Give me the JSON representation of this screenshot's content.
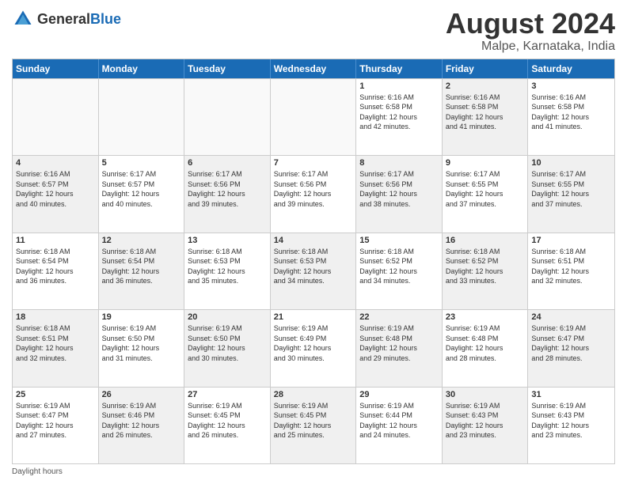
{
  "header": {
    "logo": {
      "general": "General",
      "blue": "Blue"
    },
    "title": "August 2024",
    "location": "Malpe, Karnataka, India"
  },
  "weekdays": [
    "Sunday",
    "Monday",
    "Tuesday",
    "Wednesday",
    "Thursday",
    "Friday",
    "Saturday"
  ],
  "weeks": [
    [
      {
        "day": "",
        "info": "",
        "shaded": false,
        "empty": true
      },
      {
        "day": "",
        "info": "",
        "shaded": false,
        "empty": true
      },
      {
        "day": "",
        "info": "",
        "shaded": false,
        "empty": true
      },
      {
        "day": "",
        "info": "",
        "shaded": false,
        "empty": true
      },
      {
        "day": "1",
        "info": "Sunrise: 6:16 AM\nSunset: 6:58 PM\nDaylight: 12 hours\nand 42 minutes.",
        "shaded": false,
        "empty": false
      },
      {
        "day": "2",
        "info": "Sunrise: 6:16 AM\nSunset: 6:58 PM\nDaylight: 12 hours\nand 41 minutes.",
        "shaded": true,
        "empty": false
      },
      {
        "day": "3",
        "info": "Sunrise: 6:16 AM\nSunset: 6:58 PM\nDaylight: 12 hours\nand 41 minutes.",
        "shaded": false,
        "empty": false
      }
    ],
    [
      {
        "day": "4",
        "info": "Sunrise: 6:16 AM\nSunset: 6:57 PM\nDaylight: 12 hours\nand 40 minutes.",
        "shaded": true,
        "empty": false
      },
      {
        "day": "5",
        "info": "Sunrise: 6:17 AM\nSunset: 6:57 PM\nDaylight: 12 hours\nand 40 minutes.",
        "shaded": false,
        "empty": false
      },
      {
        "day": "6",
        "info": "Sunrise: 6:17 AM\nSunset: 6:56 PM\nDaylight: 12 hours\nand 39 minutes.",
        "shaded": true,
        "empty": false
      },
      {
        "day": "7",
        "info": "Sunrise: 6:17 AM\nSunset: 6:56 PM\nDaylight: 12 hours\nand 39 minutes.",
        "shaded": false,
        "empty": false
      },
      {
        "day": "8",
        "info": "Sunrise: 6:17 AM\nSunset: 6:56 PM\nDaylight: 12 hours\nand 38 minutes.",
        "shaded": true,
        "empty": false
      },
      {
        "day": "9",
        "info": "Sunrise: 6:17 AM\nSunset: 6:55 PM\nDaylight: 12 hours\nand 37 minutes.",
        "shaded": false,
        "empty": false
      },
      {
        "day": "10",
        "info": "Sunrise: 6:17 AM\nSunset: 6:55 PM\nDaylight: 12 hours\nand 37 minutes.",
        "shaded": true,
        "empty": false
      }
    ],
    [
      {
        "day": "11",
        "info": "Sunrise: 6:18 AM\nSunset: 6:54 PM\nDaylight: 12 hours\nand 36 minutes.",
        "shaded": false,
        "empty": false
      },
      {
        "day": "12",
        "info": "Sunrise: 6:18 AM\nSunset: 6:54 PM\nDaylight: 12 hours\nand 36 minutes.",
        "shaded": true,
        "empty": false
      },
      {
        "day": "13",
        "info": "Sunrise: 6:18 AM\nSunset: 6:53 PM\nDaylight: 12 hours\nand 35 minutes.",
        "shaded": false,
        "empty": false
      },
      {
        "day": "14",
        "info": "Sunrise: 6:18 AM\nSunset: 6:53 PM\nDaylight: 12 hours\nand 34 minutes.",
        "shaded": true,
        "empty": false
      },
      {
        "day": "15",
        "info": "Sunrise: 6:18 AM\nSunset: 6:52 PM\nDaylight: 12 hours\nand 34 minutes.",
        "shaded": false,
        "empty": false
      },
      {
        "day": "16",
        "info": "Sunrise: 6:18 AM\nSunset: 6:52 PM\nDaylight: 12 hours\nand 33 minutes.",
        "shaded": true,
        "empty": false
      },
      {
        "day": "17",
        "info": "Sunrise: 6:18 AM\nSunset: 6:51 PM\nDaylight: 12 hours\nand 32 minutes.",
        "shaded": false,
        "empty": false
      }
    ],
    [
      {
        "day": "18",
        "info": "Sunrise: 6:18 AM\nSunset: 6:51 PM\nDaylight: 12 hours\nand 32 minutes.",
        "shaded": true,
        "empty": false
      },
      {
        "day": "19",
        "info": "Sunrise: 6:19 AM\nSunset: 6:50 PM\nDaylight: 12 hours\nand 31 minutes.",
        "shaded": false,
        "empty": false
      },
      {
        "day": "20",
        "info": "Sunrise: 6:19 AM\nSunset: 6:50 PM\nDaylight: 12 hours\nand 30 minutes.",
        "shaded": true,
        "empty": false
      },
      {
        "day": "21",
        "info": "Sunrise: 6:19 AM\nSunset: 6:49 PM\nDaylight: 12 hours\nand 30 minutes.",
        "shaded": false,
        "empty": false
      },
      {
        "day": "22",
        "info": "Sunrise: 6:19 AM\nSunset: 6:48 PM\nDaylight: 12 hours\nand 29 minutes.",
        "shaded": true,
        "empty": false
      },
      {
        "day": "23",
        "info": "Sunrise: 6:19 AM\nSunset: 6:48 PM\nDaylight: 12 hours\nand 28 minutes.",
        "shaded": false,
        "empty": false
      },
      {
        "day": "24",
        "info": "Sunrise: 6:19 AM\nSunset: 6:47 PM\nDaylight: 12 hours\nand 28 minutes.",
        "shaded": true,
        "empty": false
      }
    ],
    [
      {
        "day": "25",
        "info": "Sunrise: 6:19 AM\nSunset: 6:47 PM\nDaylight: 12 hours\nand 27 minutes.",
        "shaded": false,
        "empty": false
      },
      {
        "day": "26",
        "info": "Sunrise: 6:19 AM\nSunset: 6:46 PM\nDaylight: 12 hours\nand 26 minutes.",
        "shaded": true,
        "empty": false
      },
      {
        "day": "27",
        "info": "Sunrise: 6:19 AM\nSunset: 6:45 PM\nDaylight: 12 hours\nand 26 minutes.",
        "shaded": false,
        "empty": false
      },
      {
        "day": "28",
        "info": "Sunrise: 6:19 AM\nSunset: 6:45 PM\nDaylight: 12 hours\nand 25 minutes.",
        "shaded": true,
        "empty": false
      },
      {
        "day": "29",
        "info": "Sunrise: 6:19 AM\nSunset: 6:44 PM\nDaylight: 12 hours\nand 24 minutes.",
        "shaded": false,
        "empty": false
      },
      {
        "day": "30",
        "info": "Sunrise: 6:19 AM\nSunset: 6:43 PM\nDaylight: 12 hours\nand 23 minutes.",
        "shaded": true,
        "empty": false
      },
      {
        "day": "31",
        "info": "Sunrise: 6:19 AM\nSunset: 6:43 PM\nDaylight: 12 hours\nand 23 minutes.",
        "shaded": false,
        "empty": false
      }
    ]
  ],
  "footer": {
    "note": "Daylight hours"
  }
}
